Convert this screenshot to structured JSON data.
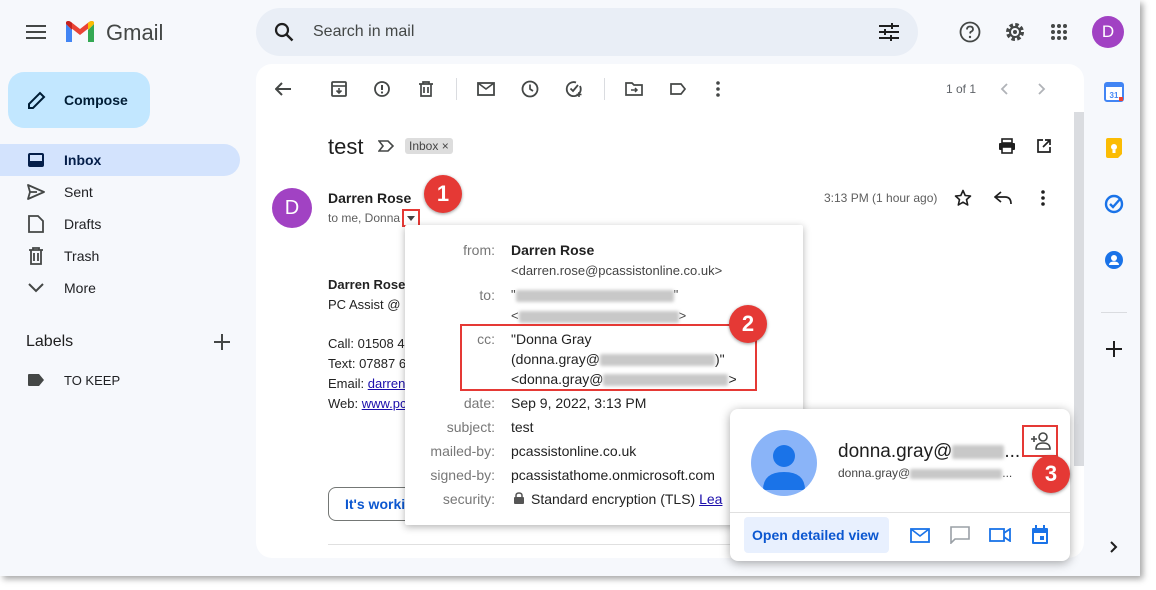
{
  "header": {
    "app_name": "Gmail",
    "search_placeholder": "Search in mail",
    "avatar_letter": "D"
  },
  "sidebar": {
    "compose_label": "Compose",
    "items": [
      {
        "label": "Inbox",
        "icon": "inbox-icon",
        "active": true
      },
      {
        "label": "Sent",
        "icon": "send-icon",
        "active": false
      },
      {
        "label": "Drafts",
        "icon": "draft-icon",
        "active": false
      },
      {
        "label": "Trash",
        "icon": "trash-icon",
        "active": false
      },
      {
        "label": "More",
        "icon": "chevron-down-icon",
        "active": false
      }
    ],
    "labels_title": "Labels",
    "labels": [
      {
        "label": "TO KEEP"
      }
    ]
  },
  "toolbar": {
    "pager": "1 of 1"
  },
  "email": {
    "subject": "test",
    "chip": "Inbox",
    "chip_close": "×",
    "sender": "Darren Rose",
    "to_line": "to me, Donna",
    "time": "3:13 PM (1 hour ago)",
    "avatar_letter": "D",
    "body": {
      "sig_name": "Darren Rose",
      "sig_company": "PC Assist @",
      "call": "Call: 01508 4",
      "text": "Text: 07887 6",
      "email_label": "Email: ",
      "email_link": "darren",
      "web_label": "Web: ",
      "web_link": "www.pc"
    },
    "smart_reply": "It's worki"
  },
  "details": {
    "from_label": "from:",
    "from_name": "Darren Rose",
    "from_email": "<darren.rose@pcassistonline.co.uk>",
    "to_label": "to:",
    "to_line1_start": "\"",
    "to_line1_end": "\"",
    "to_line2_start": "<",
    "to_line2_end": ">",
    "cc_label": "cc:",
    "cc_line1": "\"Donna Gray",
    "cc_line2_start": "(donna.gray@",
    "cc_line2_end": ")\"",
    "cc_line3_start": "<donna.gray@",
    "cc_line3_end": ">",
    "date_label": "date:",
    "date": "Sep 9, 2022, 3:13 PM",
    "subject_label": "subject:",
    "subject": "test",
    "mailed_by_label": "mailed-by:",
    "mailed_by": "pcassistonline.co.uk",
    "signed_by_label": "signed-by:",
    "signed_by": "pcassistathome.onmicrosoft.com",
    "security_label": "security:",
    "security": "Standard encryption (TLS)",
    "learn": "Lea"
  },
  "contact_card": {
    "name_start": "donna.gray@",
    "name_end": "...",
    "email_start": "donna.gray@",
    "email_end": "...",
    "open_detailed_view": "Open detailed view"
  },
  "annotations": {
    "step1": "1",
    "step2": "2",
    "step3": "3",
    "color": "#e53935"
  },
  "colors": {
    "accent": "#0b57d0",
    "active_nav": "#d3e3fd",
    "compose": "#c2e7ff",
    "avatar": "#a142c3"
  }
}
